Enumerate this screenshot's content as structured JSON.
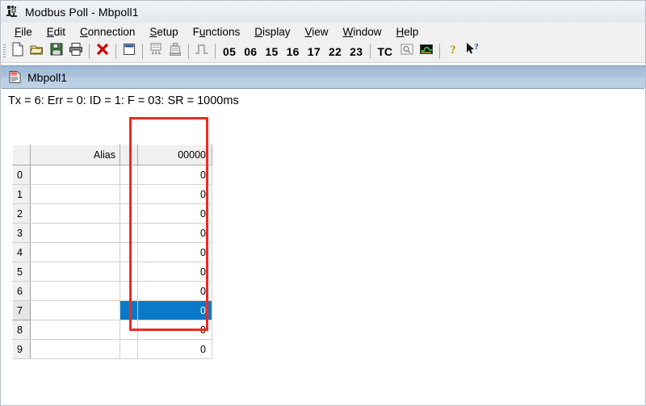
{
  "window": {
    "title": "Modbus Poll - Mbpoll1",
    "icon": "modbus-app-icon"
  },
  "menubar": {
    "items": [
      {
        "label": "File",
        "mnemonic": "F"
      },
      {
        "label": "Edit",
        "mnemonic": "E"
      },
      {
        "label": "Connection",
        "mnemonic": "C"
      },
      {
        "label": "Setup",
        "mnemonic": "S"
      },
      {
        "label": "Functions",
        "mnemonic": "u"
      },
      {
        "label": "Display",
        "mnemonic": "D"
      },
      {
        "label": "View",
        "mnemonic": "V"
      },
      {
        "label": "Window",
        "mnemonic": "W"
      },
      {
        "label": "Help",
        "mnemonic": "H"
      }
    ]
  },
  "toolbar": {
    "buttons": [
      {
        "name": "new-file-icon",
        "kind": "icon"
      },
      {
        "name": "open-file-icon",
        "kind": "icon"
      },
      {
        "name": "save-file-icon",
        "kind": "icon"
      },
      {
        "name": "print-icon",
        "kind": "icon"
      },
      {
        "name": "disconnect-icon",
        "kind": "icon"
      },
      {
        "name": "new-window-icon",
        "kind": "icon"
      },
      {
        "name": "poll-definition-icon",
        "kind": "icon"
      },
      {
        "name": "write-register-icon",
        "kind": "icon"
      },
      {
        "name": "pulse-signal-icon",
        "kind": "icon"
      }
    ],
    "function_codes": [
      "05",
      "06",
      "15",
      "16",
      "17",
      "22",
      "23"
    ],
    "tc_label": "TC",
    "right_buttons": [
      {
        "name": "magnifier-icon"
      },
      {
        "name": "chart-icon"
      },
      {
        "name": "help-icon"
      },
      {
        "name": "context-help-icon"
      }
    ]
  },
  "mdi_child": {
    "title": "Mbpoll1",
    "icon": "document-icon",
    "status_line": "Tx = 6: Err = 0: ID = 1: F = 03: SR = 1000ms",
    "status_values": {
      "tx": "6",
      "err": "0",
      "id": "1",
      "f": "03",
      "sr": "1000ms"
    }
  },
  "grid": {
    "headers": {
      "rownum": "",
      "alias": "Alias",
      "gap": "",
      "value": "00000"
    },
    "rows": [
      {
        "index": "0",
        "alias": "",
        "value": "0",
        "selected": false
      },
      {
        "index": "1",
        "alias": "",
        "value": "0",
        "selected": false
      },
      {
        "index": "2",
        "alias": "",
        "value": "0",
        "selected": false
      },
      {
        "index": "3",
        "alias": "",
        "value": "0",
        "selected": false
      },
      {
        "index": "4",
        "alias": "",
        "value": "0",
        "selected": false
      },
      {
        "index": "5",
        "alias": "",
        "value": "0",
        "selected": false
      },
      {
        "index": "6",
        "alias": "",
        "value": "0",
        "selected": false
      },
      {
        "index": "7",
        "alias": "",
        "value": "0",
        "selected": true
      },
      {
        "index": "8",
        "alias": "",
        "value": "0",
        "selected": false
      },
      {
        "index": "9",
        "alias": "",
        "value": "0",
        "selected": false
      }
    ],
    "selected_row_index": "7"
  },
  "annotation": {
    "type": "rectangle",
    "color": "#ee2b20",
    "target": "value-column-00000"
  }
}
